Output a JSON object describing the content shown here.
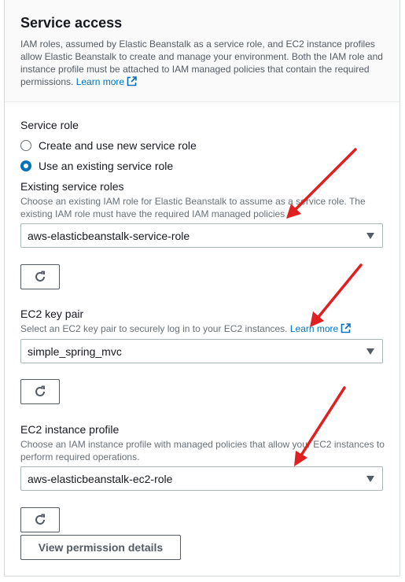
{
  "section": {
    "title": "Service access",
    "description": "IAM roles, assumed by Elastic Beanstalk as a service role, and EC2 instance profiles allow Elastic Beanstalk to create and manage your environment. Both the IAM role and instance profile must be attached to IAM managed policies that contain the required permissions.",
    "learn_more": "Learn more"
  },
  "service_role": {
    "label": "Service role",
    "options": [
      {
        "label": "Create and use new service role",
        "checked": false
      },
      {
        "label": "Use an existing service role",
        "checked": true
      }
    ]
  },
  "existing_roles": {
    "label": "Existing service roles",
    "hint": "Choose an existing IAM role for Elastic Beanstalk to assume as a service role. The existing IAM role must have the required IAM managed policies",
    "selected": "aws-elasticbeanstalk-service-role"
  },
  "key_pair": {
    "label": "EC2 key pair",
    "hint": "Select an EC2 key pair to securely log in to your EC2 instances.",
    "learn_more": "Learn more",
    "selected": "simple_spring_mvc"
  },
  "instance_profile": {
    "label": "EC2 instance profile",
    "hint": "Choose an IAM instance profile with managed policies that allow your EC2 instances to perform required operations.",
    "selected": "aws-elasticbeanstalk-ec2-role"
  },
  "buttons": {
    "view_permissions": "View permission details"
  },
  "icons": {
    "refresh": "refresh-icon",
    "external_link": "external-link-icon",
    "dropdown": "caret-down-icon"
  },
  "colors": {
    "link": "#0073bb",
    "annotation_arrow": "#e02020"
  }
}
